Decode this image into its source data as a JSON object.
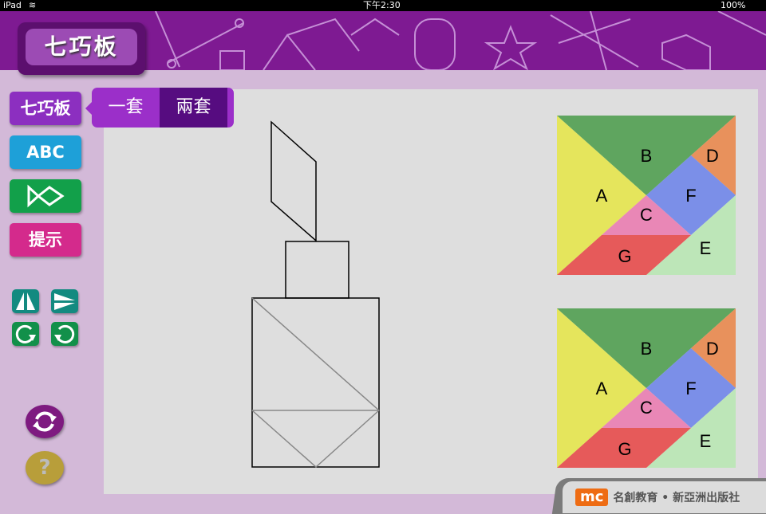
{
  "status_bar": {
    "device": "iPad",
    "time": "下午2:30",
    "battery": "100%"
  },
  "app_title": "七巧板",
  "sidebar": {
    "tangram_label": "七巧板",
    "abc_label": "ABC",
    "hint_label": "提示"
  },
  "set_selector": {
    "options": [
      "一套",
      "兩套"
    ],
    "selected": "兩套"
  },
  "pieces": {
    "A": "A",
    "B": "B",
    "C": "C",
    "D": "D",
    "E": "E",
    "F": "F",
    "G": "G"
  },
  "piece_colors": {
    "A": "#e5e55c",
    "B": "#5fa55f",
    "C": "#e987b6",
    "D": "#e8915c",
    "E": "#bde6b8",
    "F": "#7b8fe8",
    "G": "#e65a5a"
  },
  "footer": {
    "logo": "mc",
    "publisher": "名創教育 • 新亞洲出版社"
  }
}
